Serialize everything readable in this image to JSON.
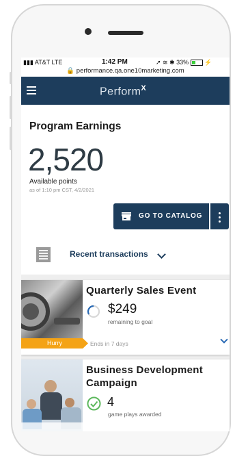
{
  "status_bar": {
    "carrier": "AT&T  LTE",
    "time": "1:42 PM",
    "battery": "33%",
    "url": "performance.qa.one10marketing.com"
  },
  "app": {
    "brand": "Perform",
    "brand_mark": "X",
    "header_color": "#1d3d5c"
  },
  "earnings": {
    "title": "Program Earnings",
    "points": "2,520",
    "points_label": "Available points",
    "as_of": "as of 1:10 pm CST, 4/2/2021",
    "catalog_button": "GO TO CATALOG",
    "recent_transactions": "Recent transactions"
  },
  "promotions": [
    {
      "title": "Quarterly Sales Event",
      "value": "$249",
      "sub": "remaining to goal",
      "badge": "Hurry",
      "ends": "Ends in 7 days",
      "badge_color": "#f4a316"
    },
    {
      "title": "Business Development Campaign",
      "value": "4",
      "sub": "game plays awarded",
      "status_color": "#5cb85c"
    }
  ],
  "icons": [
    "menu-icon",
    "store-icon",
    "more-vert-icon",
    "receipt-icon",
    "chevron-down-icon",
    "progress-ring-icon",
    "check-circle-icon",
    "lock-icon"
  ]
}
